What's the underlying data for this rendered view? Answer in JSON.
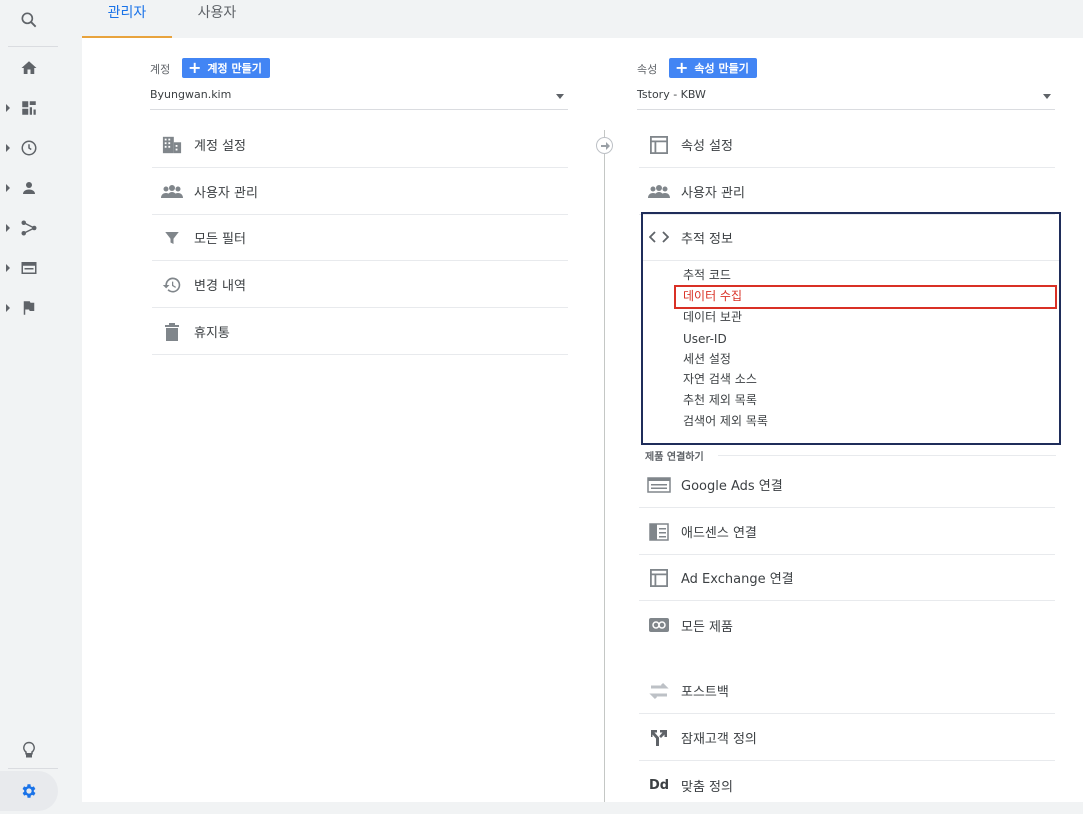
{
  "tabs": {
    "admin": "관리자",
    "user": "사용자"
  },
  "account": {
    "label": "계정",
    "create_button": "계정 만들기",
    "selected": "Byungwan.kim",
    "items": [
      {
        "label": "계정 설정",
        "icon": "building-icon"
      },
      {
        "label": "사용자 관리",
        "icon": "people-icon"
      },
      {
        "label": "모든 필터",
        "icon": "filter-icon"
      },
      {
        "label": "변경 내역",
        "icon": "history-icon"
      },
      {
        "label": "휴지통",
        "icon": "trash-icon"
      }
    ]
  },
  "property": {
    "label": "속성",
    "create_button": "속성 만들기",
    "selected": "Tstory - KBW",
    "items": [
      {
        "label": "속성 설정",
        "icon": "property-settings-icon"
      },
      {
        "label": "사용자 관리",
        "icon": "people-icon"
      }
    ],
    "tracking": {
      "label": "추적 정보",
      "icon": "code-icon",
      "subitems": [
        "추적 코드",
        "데이터 수집",
        "데이터 보관",
        "User-ID",
        "세션 설정",
        "자연 검색 소스",
        "추천 제외 목록",
        "검색어 제외 목록"
      ],
      "highlighted": "데이터 수집"
    },
    "product_linking_label": "제품 연결하기",
    "product_items": [
      {
        "label": "Google Ads 연결",
        "icon": "google-ads-icon"
      },
      {
        "label": "애드센스 연결",
        "icon": "adsense-icon"
      },
      {
        "label": "Ad Exchange 연결",
        "icon": "ad-exchange-icon"
      },
      {
        "label": "모든 제품",
        "icon": "link-icon"
      }
    ],
    "other_items": [
      {
        "label": "포스트백",
        "icon": "postback-icon"
      },
      {
        "label": "잠재고객 정의",
        "icon": "audience-icon"
      },
      {
        "label": "맞춤 정의",
        "icon": "dd-icon",
        "icon_text": "Dd"
      }
    ]
  },
  "colors": {
    "accent": "#1a73e8",
    "button": "#4285f4",
    "highlight": "#d93025",
    "box": "#1f2d5a"
  }
}
